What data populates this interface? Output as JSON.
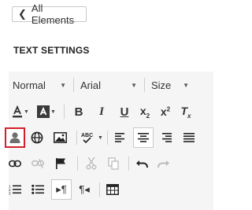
{
  "back_button": {
    "label": "All Elements"
  },
  "section": {
    "title": "TEXT SETTINGS"
  },
  "toolbar": {
    "format_value": "Normal",
    "font_value": "Arial",
    "size_value": "Size",
    "highlight_color": "#d21f2b"
  }
}
